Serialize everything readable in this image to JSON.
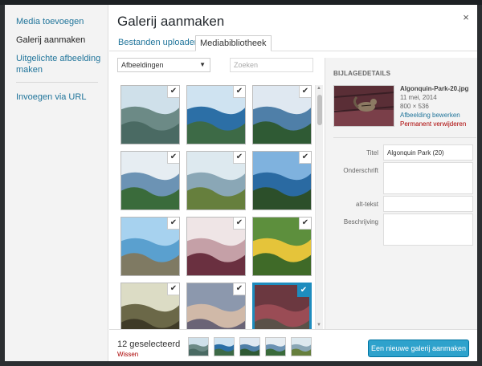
{
  "modal": {
    "title": "Galerij aanmaken",
    "close_glyph": "×"
  },
  "menu": {
    "items": [
      {
        "label": "Media toevoegen",
        "active": false
      },
      {
        "label": "Galerij aanmaken",
        "active": true
      },
      {
        "label": "Uitgelichte afbeelding maken",
        "active": false
      },
      {
        "label": "Invoegen via URL",
        "active": false
      }
    ]
  },
  "tabs": [
    {
      "label": "Bestanden uploaden",
      "active": false
    },
    {
      "label": "Mediabibliotheek",
      "active": true
    }
  ],
  "toolbar": {
    "filter_value": "Afbeeldingen",
    "search_placeholder": "Zoeken"
  },
  "grid": {
    "items": [
      {
        "name": "aerial-islands",
        "selected": true,
        "scene": [
          "#cfe0ea",
          "#6c8a86",
          "#4a6a63"
        ]
      },
      {
        "name": "aerial-lake",
        "selected": true,
        "scene": [
          "#cfe3f1",
          "#2c6fa6",
          "#3d6a46"
        ]
      },
      {
        "name": "lake-forest",
        "selected": true,
        "scene": [
          "#dfe8f1",
          "#4f7fa8",
          "#2f5a34"
        ]
      },
      {
        "name": "river-bay",
        "selected": true,
        "scene": [
          "#e6edf2",
          "#6c93b4",
          "#3a6b3b"
        ]
      },
      {
        "name": "bridge-valley",
        "selected": true,
        "scene": [
          "#dde9ef",
          "#8aa7b6",
          "#667f3d"
        ]
      },
      {
        "name": "lake-pines",
        "selected": true,
        "scene": [
          "#7fb2de",
          "#2a6aa2",
          "#2c4f2a"
        ]
      },
      {
        "name": "rocky-coast",
        "selected": true,
        "scene": [
          "#a7d2ef",
          "#5aa0cf",
          "#7f7a63"
        ]
      },
      {
        "name": "flower-closeup",
        "selected": true,
        "scene": [
          "#efe5e6",
          "#c5a0a7",
          "#6a3040"
        ]
      },
      {
        "name": "yellow-flower",
        "selected": true,
        "scene": [
          "#5d8f3d",
          "#e5c43a",
          "#3f6a28"
        ]
      },
      {
        "name": "moose",
        "selected": true,
        "scene": [
          "#dcdcc5",
          "#6b6848",
          "#3e3a27"
        ]
      },
      {
        "name": "sunset-lake",
        "selected": true,
        "scene": [
          "#8c98ad",
          "#d0b9a8",
          "#6a6476"
        ]
      },
      {
        "name": "chipmunk",
        "selected": true,
        "current": true,
        "scene": [
          "#6b3840",
          "#9a4c55",
          "#5a5148"
        ]
      }
    ],
    "check_glyph": "✔"
  },
  "attachment_details": {
    "heading": "BIJLAGEDETAILS",
    "filename": "Algonquin-Park-20.jpg",
    "date": "11 mei, 2014",
    "dimensions": "800 × 536",
    "edit_link": "Afbeelding bewerken",
    "delete_link": "Permanent verwijderen",
    "fields": [
      {
        "label": "Titel",
        "value": "Algonquin Park (20)"
      },
      {
        "label": "Onderschrift",
        "value": ""
      },
      {
        "label": "alt-tekst",
        "value": ""
      },
      {
        "label": "Beschrijving",
        "value": ""
      }
    ]
  },
  "footer": {
    "selection_count": "12 geselecteerd",
    "clear_label": "Wissen",
    "create_button": "Een nieuwe galerij aanmaken"
  },
  "colors": {
    "accent": "#1e8cbe",
    "button": "#2ea2cc",
    "link": "#21759b",
    "danger": "#a00000"
  }
}
